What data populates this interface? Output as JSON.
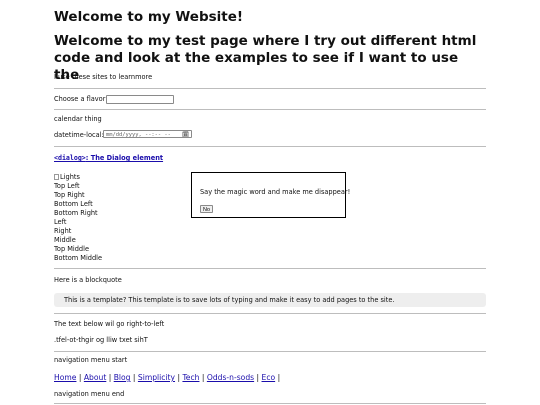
{
  "header": {
    "title": "Welcome to my Website!",
    "subtitle": "Welcome to my test page where I try out different html code and look at the examples to see if I want to use the"
  },
  "intro": {
    "learn_text": "I use these sites to learnmore"
  },
  "flavor": {
    "label": "Choose a flavor:",
    "value": ""
  },
  "calendar": {
    "heading": "calendar thing",
    "label": "datetime-local:",
    "placeholder": "mm/dd/yyyy, --:-- --",
    "icon": "calendar-icon"
  },
  "dialog_section": {
    "link_code": "<dialog>",
    "link_text": ": The Dialog element",
    "img_alt": "Lights",
    "positions": [
      "Top Left",
      "Top Right",
      "Bottom Left",
      "Bottom Right",
      "Left",
      "Right",
      "Middle",
      "Top Middle",
      "Bottom Middle"
    ],
    "dialog_message": "Say the magic word and make me disappear!",
    "dialog_button": "No"
  },
  "blockquote": {
    "label": "Here is a blockquote",
    "text": "This is a template? This template is to save lots of typing and make it easy to add pages to the site."
  },
  "rtl": {
    "label": "The text below wil go right-to-left",
    "text": ".tfel-ot-thgir og lliw txet sihT"
  },
  "nav": {
    "start": "navigation menu start",
    "items": [
      "Home",
      "About",
      "Blog",
      "Simplicity",
      "Tech",
      "Odds-n-sods",
      "Eco"
    ],
    "end": "navigation menu end"
  }
}
